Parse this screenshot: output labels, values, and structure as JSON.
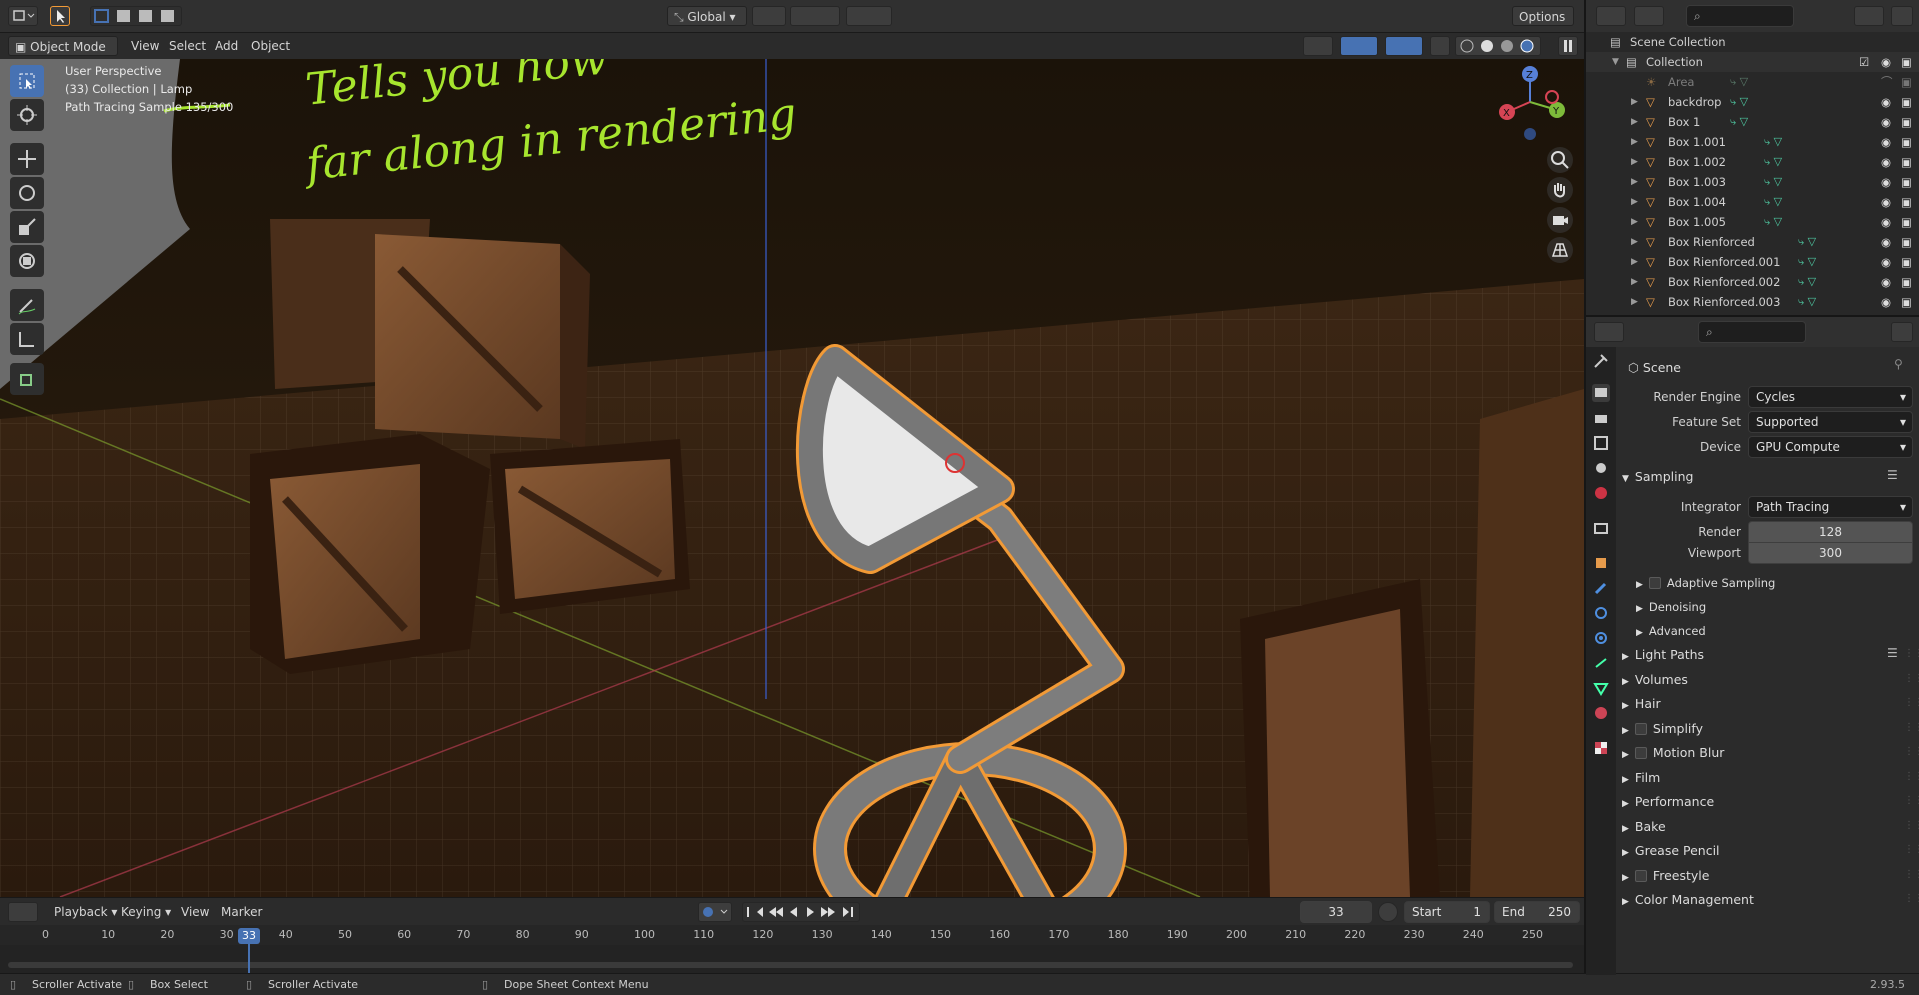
{
  "header": {
    "mode": "Object Mode",
    "menus": [
      "View",
      "Select",
      "Add",
      "Object"
    ],
    "orientation": "Global",
    "options": "Options"
  },
  "viewport": {
    "info_line1": "User Perspective",
    "info_line2": "(33) Collection | Lamp",
    "info_line3": "Path Tracing Sample 135/300",
    "annotation_line1": "Tells you how",
    "annotation_line2": "far along in rendering"
  },
  "timeline": {
    "menus": [
      "Playback",
      "Keying",
      "View",
      "Marker"
    ],
    "current_frame": "33",
    "start_label": "Start",
    "start_value": "1",
    "end_label": "End",
    "end_value": "250",
    "ticks": [
      "0",
      "10",
      "20",
      "30",
      "40",
      "50",
      "60",
      "70",
      "80",
      "90",
      "100",
      "110",
      "120",
      "130",
      "140",
      "150",
      "160",
      "170",
      "180",
      "190",
      "200",
      "210",
      "220",
      "230",
      "240",
      "250"
    ],
    "playhead": "33"
  },
  "statusbar": {
    "items": [
      "Scroller Activate",
      "Box Select",
      "Scroller Activate",
      "Dope Sheet Context Menu"
    ],
    "version": "2.93.5"
  },
  "outliner": {
    "root": "Scene Collection",
    "collection": "Collection",
    "items": [
      "Area",
      "backdrop",
      "Box 1",
      "Box 1.001",
      "Box 1.002",
      "Box 1.003",
      "Box 1.004",
      "Box 1.005",
      "Box Rienforced",
      "Box Rienforced.001",
      "Box Rienforced.002",
      "Box Rienforced.003"
    ]
  },
  "properties": {
    "context": "Scene",
    "render_engine_label": "Render Engine",
    "render_engine": "Cycles",
    "feature_set_label": "Feature Set",
    "feature_set": "Supported",
    "device_label": "Device",
    "device": "GPU Compute",
    "sampling": "Sampling",
    "integrator_label": "Integrator",
    "integrator": "Path Tracing",
    "render_label": "Render",
    "render_samples": "128",
    "viewport_label": "Viewport",
    "viewport_samples": "300",
    "subpanels": [
      "Adaptive Sampling",
      "Denoising",
      "Advanced"
    ],
    "panels": [
      "Light Paths",
      "Volumes",
      "Hair",
      "Simplify",
      "Motion Blur",
      "Film",
      "Performance",
      "Bake",
      "Grease Pencil",
      "Freestyle",
      "Color Management"
    ]
  },
  "colors": {
    "accent": "#4772b3",
    "selection_outline": "#f29a36",
    "annotation": "#a7e52e",
    "object_icon": "#e69b4c"
  }
}
